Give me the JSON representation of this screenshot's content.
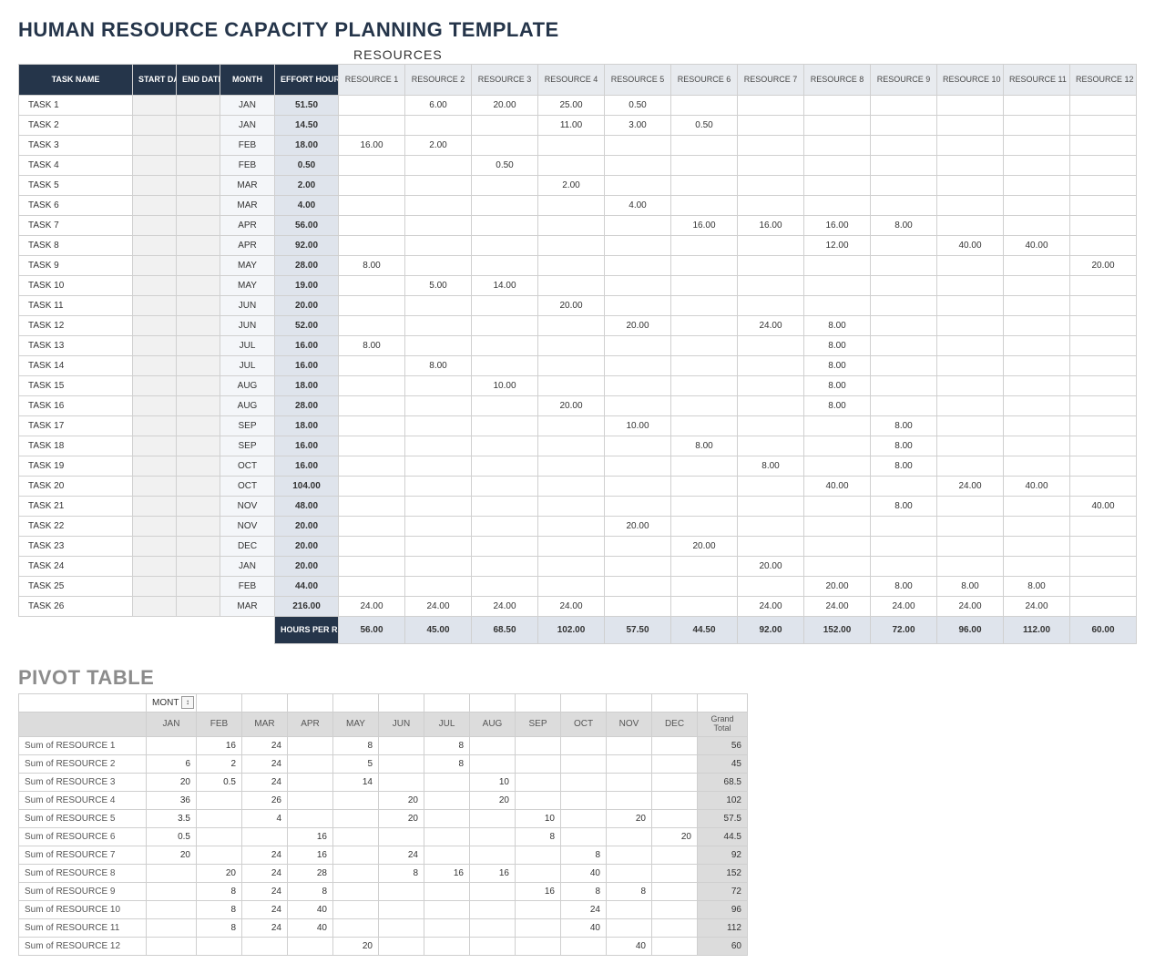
{
  "title": "HUMAN RESOURCE CAPACITY PLANNING TEMPLATE",
  "resources_label": "RESOURCES",
  "pivot_title": "PIVOT TABLE",
  "headers": {
    "task": "TASK NAME",
    "start": "START DATE",
    "end": "END DATE",
    "month": "MONTH",
    "effort": "EFFORT HOURS",
    "resources": [
      "RESOURCE 1",
      "RESOURCE 2",
      "RESOURCE 3",
      "RESOURCE 4",
      "RESOURCE 5",
      "RESOURCE 6",
      "RESOURCE 7",
      "RESOURCE 8",
      "RESOURCE 9",
      "RESOURCE 10",
      "RESOURCE 11",
      "RESOURCE 12"
    ]
  },
  "rows": [
    {
      "task": "TASK 1",
      "month": "JAN",
      "effort": "51.50",
      "r": [
        "",
        "6.00",
        "20.00",
        "25.00",
        "0.50",
        "",
        "",
        "",
        "",
        "",
        "",
        ""
      ]
    },
    {
      "task": "TASK 2",
      "month": "JAN",
      "effort": "14.50",
      "r": [
        "",
        "",
        "",
        "11.00",
        "3.00",
        "0.50",
        "",
        "",
        "",
        "",
        "",
        ""
      ]
    },
    {
      "task": "TASK 3",
      "month": "FEB",
      "effort": "18.00",
      "r": [
        "16.00",
        "2.00",
        "",
        "",
        "",
        "",
        "",
        "",
        "",
        "",
        "",
        ""
      ]
    },
    {
      "task": "TASK 4",
      "month": "FEB",
      "effort": "0.50",
      "r": [
        "",
        "",
        "0.50",
        "",
        "",
        "",
        "",
        "",
        "",
        "",
        "",
        ""
      ]
    },
    {
      "task": "TASK 5",
      "month": "MAR",
      "effort": "2.00",
      "r": [
        "",
        "",
        "",
        "2.00",
        "",
        "",
        "",
        "",
        "",
        "",
        "",
        ""
      ]
    },
    {
      "task": "TASK 6",
      "month": "MAR",
      "effort": "4.00",
      "r": [
        "",
        "",
        "",
        "",
        "4.00",
        "",
        "",
        "",
        "",
        "",
        "",
        ""
      ]
    },
    {
      "task": "TASK 7",
      "month": "APR",
      "effort": "56.00",
      "r": [
        "",
        "",
        "",
        "",
        "",
        "16.00",
        "16.00",
        "16.00",
        "8.00",
        "",
        "",
        ""
      ]
    },
    {
      "task": "TASK 8",
      "month": "APR",
      "effort": "92.00",
      "r": [
        "",
        "",
        "",
        "",
        "",
        "",
        "",
        "12.00",
        "",
        "40.00",
        "40.00",
        ""
      ]
    },
    {
      "task": "TASK 9",
      "month": "MAY",
      "effort": "28.00",
      "r": [
        "8.00",
        "",
        "",
        "",
        "",
        "",
        "",
        "",
        "",
        "",
        "",
        "20.00"
      ]
    },
    {
      "task": "TASK 10",
      "month": "MAY",
      "effort": "19.00",
      "r": [
        "",
        "5.00",
        "14.00",
        "",
        "",
        "",
        "",
        "",
        "",
        "",
        "",
        ""
      ]
    },
    {
      "task": "TASK 11",
      "month": "JUN",
      "effort": "20.00",
      "r": [
        "",
        "",
        "",
        "20.00",
        "",
        "",
        "",
        "",
        "",
        "",
        "",
        ""
      ]
    },
    {
      "task": "TASK 12",
      "month": "JUN",
      "effort": "52.00",
      "r": [
        "",
        "",
        "",
        "",
        "20.00",
        "",
        "24.00",
        "8.00",
        "",
        "",
        "",
        ""
      ]
    },
    {
      "task": "TASK 13",
      "month": "JUL",
      "effort": "16.00",
      "r": [
        "8.00",
        "",
        "",
        "",
        "",
        "",
        "",
        "8.00",
        "",
        "",
        "",
        ""
      ]
    },
    {
      "task": "TASK 14",
      "month": "JUL",
      "effort": "16.00",
      "r": [
        "",
        "8.00",
        "",
        "",
        "",
        "",
        "",
        "8.00",
        "",
        "",
        "",
        ""
      ]
    },
    {
      "task": "TASK 15",
      "month": "AUG",
      "effort": "18.00",
      "r": [
        "",
        "",
        "10.00",
        "",
        "",
        "",
        "",
        "8.00",
        "",
        "",
        "",
        ""
      ]
    },
    {
      "task": "TASK 16",
      "month": "AUG",
      "effort": "28.00",
      "r": [
        "",
        "",
        "",
        "20.00",
        "",
        "",
        "",
        "8.00",
        "",
        "",
        "",
        ""
      ]
    },
    {
      "task": "TASK 17",
      "month": "SEP",
      "effort": "18.00",
      "r": [
        "",
        "",
        "",
        "",
        "10.00",
        "",
        "",
        "",
        "8.00",
        "",
        "",
        ""
      ]
    },
    {
      "task": "TASK 18",
      "month": "SEP",
      "effort": "16.00",
      "r": [
        "",
        "",
        "",
        "",
        "",
        "8.00",
        "",
        "",
        "8.00",
        "",
        "",
        ""
      ]
    },
    {
      "task": "TASK 19",
      "month": "OCT",
      "effort": "16.00",
      "r": [
        "",
        "",
        "",
        "",
        "",
        "",
        "8.00",
        "",
        "8.00",
        "",
        "",
        ""
      ]
    },
    {
      "task": "TASK 20",
      "month": "OCT",
      "effort": "104.00",
      "r": [
        "",
        "",
        "",
        "",
        "",
        "",
        "",
        "40.00",
        "",
        "24.00",
        "40.00",
        ""
      ]
    },
    {
      "task": "TASK 21",
      "month": "NOV",
      "effort": "48.00",
      "r": [
        "",
        "",
        "",
        "",
        "",
        "",
        "",
        "",
        "8.00",
        "",
        "",
        "40.00"
      ]
    },
    {
      "task": "TASK 22",
      "month": "NOV",
      "effort": "20.00",
      "r": [
        "",
        "",
        "",
        "",
        "20.00",
        "",
        "",
        "",
        "",
        "",
        "",
        ""
      ]
    },
    {
      "task": "TASK 23",
      "month": "DEC",
      "effort": "20.00",
      "r": [
        "",
        "",
        "",
        "",
        "",
        "20.00",
        "",
        "",
        "",
        "",
        "",
        ""
      ]
    },
    {
      "task": "TASK 24",
      "month": "JAN",
      "effort": "20.00",
      "r": [
        "",
        "",
        "",
        "",
        "",
        "",
        "20.00",
        "",
        "",
        "",
        "",
        ""
      ]
    },
    {
      "task": "TASK 25",
      "month": "FEB",
      "effort": "44.00",
      "r": [
        "",
        "",
        "",
        "",
        "",
        "",
        "",
        "20.00",
        "8.00",
        "8.00",
        "8.00",
        ""
      ]
    },
    {
      "task": "TASK 26",
      "month": "MAR",
      "effort": "216.00",
      "r": [
        "24.00",
        "24.00",
        "24.00",
        "24.00",
        "",
        "",
        "24.00",
        "24.00",
        "24.00",
        "24.00",
        "24.00",
        ""
      ]
    }
  ],
  "footer": {
    "label": "HOURS PER RESOURCE",
    "values": [
      "56.00",
      "45.00",
      "68.50",
      "102.00",
      "57.50",
      "44.50",
      "92.00",
      "152.00",
      "72.00",
      "96.00",
      "112.00",
      "60.00"
    ]
  },
  "pivot": {
    "filter_label": "MONT",
    "months": [
      "JAN",
      "FEB",
      "MAR",
      "APR",
      "MAY",
      "JUN",
      "JUL",
      "AUG",
      "SEP",
      "OCT",
      "NOV",
      "DEC"
    ],
    "grand_total_label": "Grand Total",
    "rows": [
      {
        "label": "Sum of RESOURCE 1",
        "v": [
          "",
          "16",
          "24",
          "",
          "8",
          "",
          "8",
          "",
          "",
          "",
          "",
          ""
        ],
        "gt": "56"
      },
      {
        "label": "Sum of RESOURCE 2",
        "v": [
          "6",
          "2",
          "24",
          "",
          "5",
          "",
          "8",
          "",
          "",
          "",
          "",
          ""
        ],
        "gt": "45"
      },
      {
        "label": "Sum of RESOURCE 3",
        "v": [
          "20",
          "0.5",
          "24",
          "",
          "14",
          "",
          "",
          "10",
          "",
          "",
          "",
          ""
        ],
        "gt": "68.5"
      },
      {
        "label": "Sum of RESOURCE 4",
        "v": [
          "36",
          "",
          "26",
          "",
          "",
          "20",
          "",
          "20",
          "",
          "",
          "",
          ""
        ],
        "gt": "102"
      },
      {
        "label": "Sum of RESOURCE 5",
        "v": [
          "3.5",
          "",
          "4",
          "",
          "",
          "20",
          "",
          "",
          "10",
          "",
          "20",
          ""
        ],
        "gt": "57.5"
      },
      {
        "label": "Sum of RESOURCE 6",
        "v": [
          "0.5",
          "",
          "",
          "16",
          "",
          "",
          "",
          "",
          "8",
          "",
          "",
          "20"
        ],
        "gt": "44.5"
      },
      {
        "label": "Sum of RESOURCE 7",
        "v": [
          "20",
          "",
          "24",
          "16",
          "",
          "24",
          "",
          "",
          "",
          "8",
          "",
          ""
        ],
        "gt": "92"
      },
      {
        "label": "Sum of RESOURCE 8",
        "v": [
          "",
          "20",
          "24",
          "28",
          "",
          "8",
          "16",
          "16",
          "",
          "40",
          "",
          ""
        ],
        "gt": "152"
      },
      {
        "label": "Sum of RESOURCE 9",
        "v": [
          "",
          "8",
          "24",
          "8",
          "",
          "",
          "",
          "",
          "16",
          "8",
          "8",
          ""
        ],
        "gt": "72"
      },
      {
        "label": "Sum of RESOURCE 10",
        "v": [
          "",
          "8",
          "24",
          "40",
          "",
          "",
          "",
          "",
          "",
          "24",
          "",
          ""
        ],
        "gt": "96"
      },
      {
        "label": "Sum of RESOURCE 11",
        "v": [
          "",
          "8",
          "24",
          "40",
          "",
          "",
          "",
          "",
          "",
          "40",
          "",
          ""
        ],
        "gt": "112"
      },
      {
        "label": "Sum of RESOURCE 12",
        "v": [
          "",
          "",
          "",
          "",
          "20",
          "",
          "",
          "",
          "",
          "",
          "40",
          ""
        ],
        "gt": "60"
      }
    ]
  }
}
